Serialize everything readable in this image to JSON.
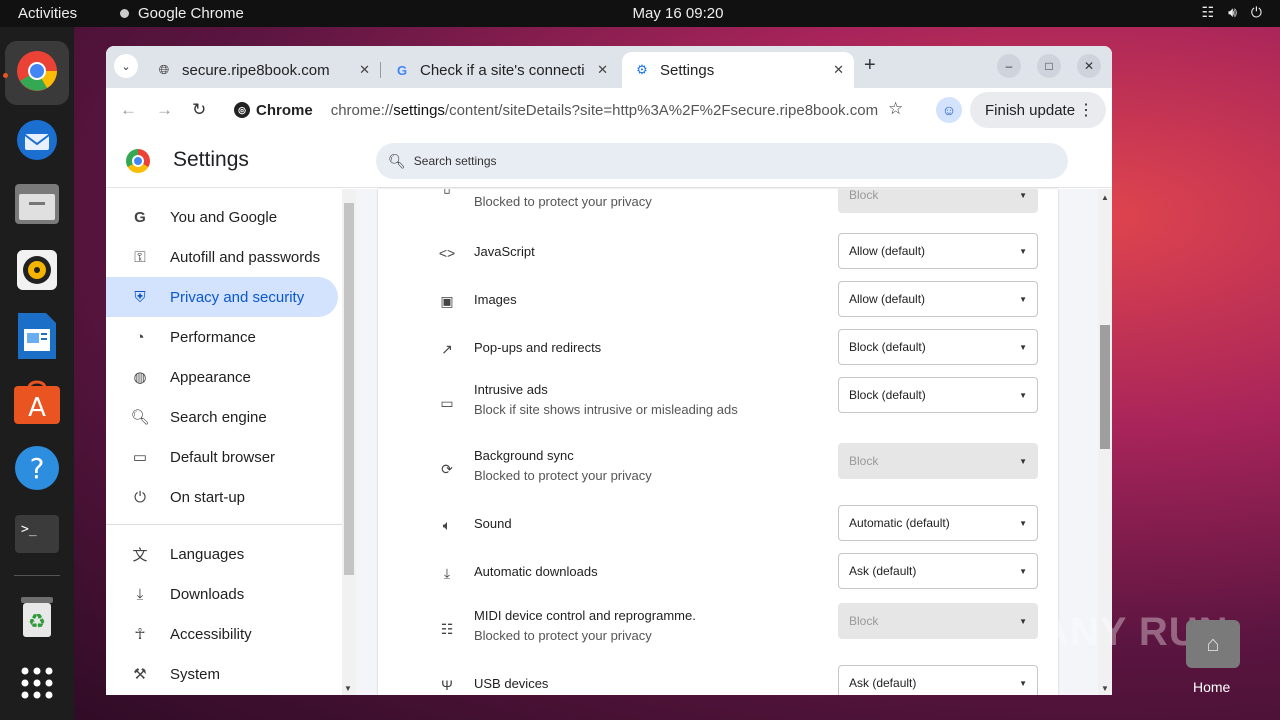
{
  "topbar": {
    "activities": "Activities",
    "app_name": "Google Chrome",
    "clock": "May 16  09:20"
  },
  "dock": {
    "apps": [
      "chrome-icon",
      "thunderbird-icon",
      "files-icon",
      "rhythmbox-icon",
      "writer-icon",
      "app-center-icon",
      "help-icon",
      "terminal-icon",
      "trash-icon",
      "show-apps-icon"
    ]
  },
  "tabs": [
    {
      "label": "secure.ripe8book.com",
      "icon": "globe-icon"
    },
    {
      "label": "Check if a site's connecti",
      "icon": "google-icon"
    },
    {
      "label": "Settings",
      "icon": "gear-icon"
    }
  ],
  "toolbar": {
    "chip_label": "Chrome",
    "url_prefix": "chrome://",
    "url_host": "settings",
    "url_rest": "/content/siteDetails?site=http%3A%2F%2Fsecure.ripe8book.com",
    "finish_update": "Finish update"
  },
  "settings": {
    "title": "Settings",
    "search_placeholder": "Search settings"
  },
  "sidebar": {
    "items": [
      {
        "label": "You and Google",
        "icon": "google-g-icon"
      },
      {
        "label": "Autofill and passwords",
        "icon": "key-icon"
      },
      {
        "label": "Privacy and security",
        "icon": "shield-icon",
        "selected": true
      },
      {
        "label": "Performance",
        "icon": "speedometer-icon"
      },
      {
        "label": "Appearance",
        "icon": "palette-icon"
      },
      {
        "label": "Search engine",
        "icon": "search-icon"
      },
      {
        "label": "Default browser",
        "icon": "browser-window-icon"
      },
      {
        "label": "On start-up",
        "icon": "power-icon"
      },
      {
        "label": "Languages",
        "icon": "translate-icon"
      },
      {
        "label": "Downloads",
        "icon": "download-icon"
      },
      {
        "label": "Accessibility",
        "icon": "accessibility-icon"
      },
      {
        "label": "System",
        "icon": "wrench-icon"
      }
    ]
  },
  "permissions": [
    {
      "title": "",
      "sub": "Blocked to protect your privacy",
      "value": "Block",
      "disabled": true,
      "icon": "notification-icon"
    },
    {
      "title": "JavaScript",
      "sub": "",
      "value": "Allow (default)",
      "disabled": false,
      "icon": "code-icon"
    },
    {
      "title": "Images",
      "sub": "",
      "value": "Allow (default)",
      "disabled": false,
      "icon": "image-icon"
    },
    {
      "title": "Pop-ups and redirects",
      "sub": "",
      "value": "Block (default)",
      "disabled": false,
      "icon": "open-external-icon"
    },
    {
      "title": "Intrusive ads",
      "sub": "Block if site shows intrusive or misleading ads",
      "value": "Block (default)",
      "disabled": false,
      "icon": "ads-window-icon"
    },
    {
      "title": "Background sync",
      "sub": "Blocked to protect your privacy",
      "value": "Block",
      "disabled": true,
      "icon": "sync-icon"
    },
    {
      "title": "Sound",
      "sub": "",
      "value": "Automatic (default)",
      "disabled": false,
      "icon": "speaker-icon"
    },
    {
      "title": "Automatic downloads",
      "sub": "",
      "value": "Ask (default)",
      "disabled": false,
      "icon": "download-icon"
    },
    {
      "title": "MIDI device control and reprogramme.",
      "sub": "Blocked to protect your privacy",
      "value": "Block",
      "disabled": true,
      "icon": "piano-icon"
    },
    {
      "title": "USB devices",
      "sub": "",
      "value": "Ask (default)",
      "disabled": false,
      "icon": "usb-icon"
    }
  ],
  "desktop": {
    "watermark": "ANY RUN",
    "home_label": "Home"
  }
}
